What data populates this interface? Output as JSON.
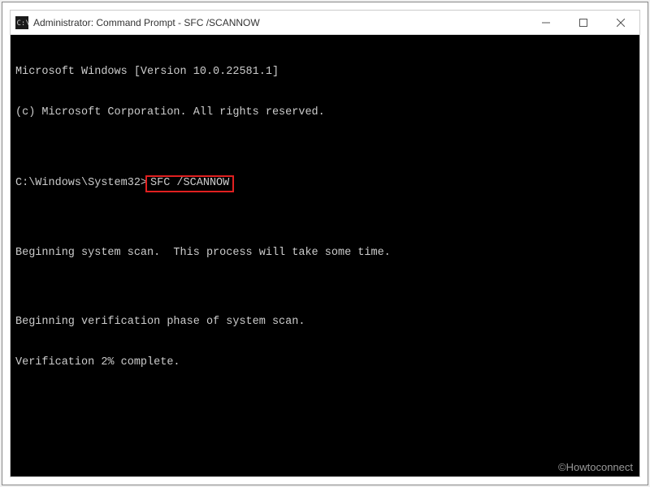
{
  "window": {
    "title": "Administrator: Command Prompt - SFC  /SCANNOW"
  },
  "terminal": {
    "line1": "Microsoft Windows [Version 10.0.22581.1]",
    "line2": "(c) Microsoft Corporation. All rights reserved.",
    "blank1": "",
    "prompt_path": "C:\\Windows\\System32>",
    "command": "SFC /SCANNOW",
    "blank2": "",
    "line3": "Beginning system scan.  This process will take some time.",
    "blank3": "",
    "line4": "Beginning verification phase of system scan.",
    "line5": "Verification 2% complete."
  },
  "watermark": "©Howtoconnect"
}
